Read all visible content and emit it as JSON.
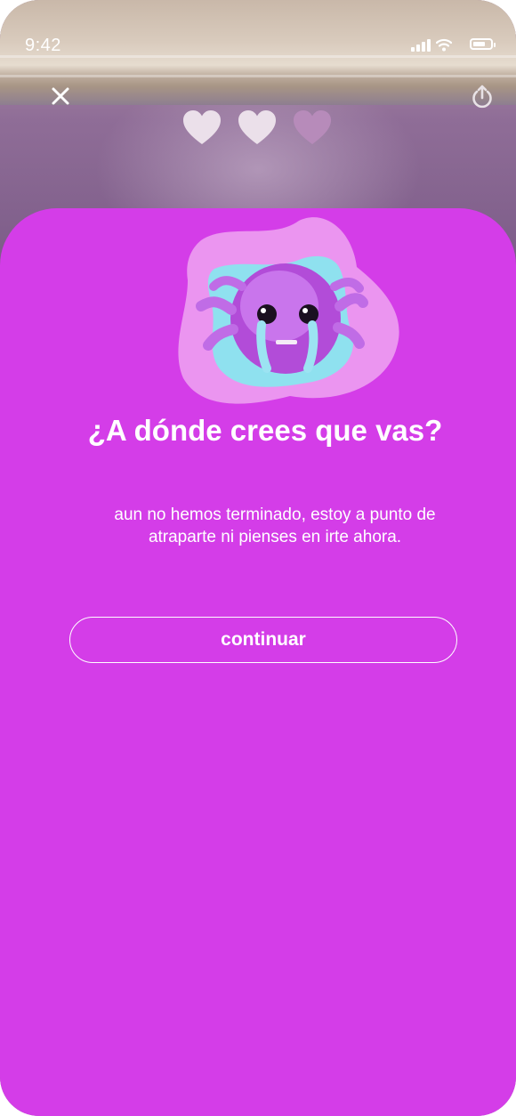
{
  "status_bar": {
    "time": "9:42"
  },
  "header": {
    "close_icon": "close-icon",
    "share_icon": "share-icon",
    "hearts": [
      {
        "state": "full"
      },
      {
        "state": "full"
      },
      {
        "state": "empty"
      }
    ]
  },
  "dialog": {
    "title": "¿A dónde crees que vas?",
    "message": "aun no hemos terminado, estoy a punto de atraparte ni pienses en irte ahora.",
    "continue_label": "continuar",
    "sticker": "crying-monster-sticker"
  },
  "colors": {
    "card": "#d43de8",
    "text": "#ffffff",
    "heart_full": "#ebe0ea",
    "heart_empty": "#b78bba"
  }
}
